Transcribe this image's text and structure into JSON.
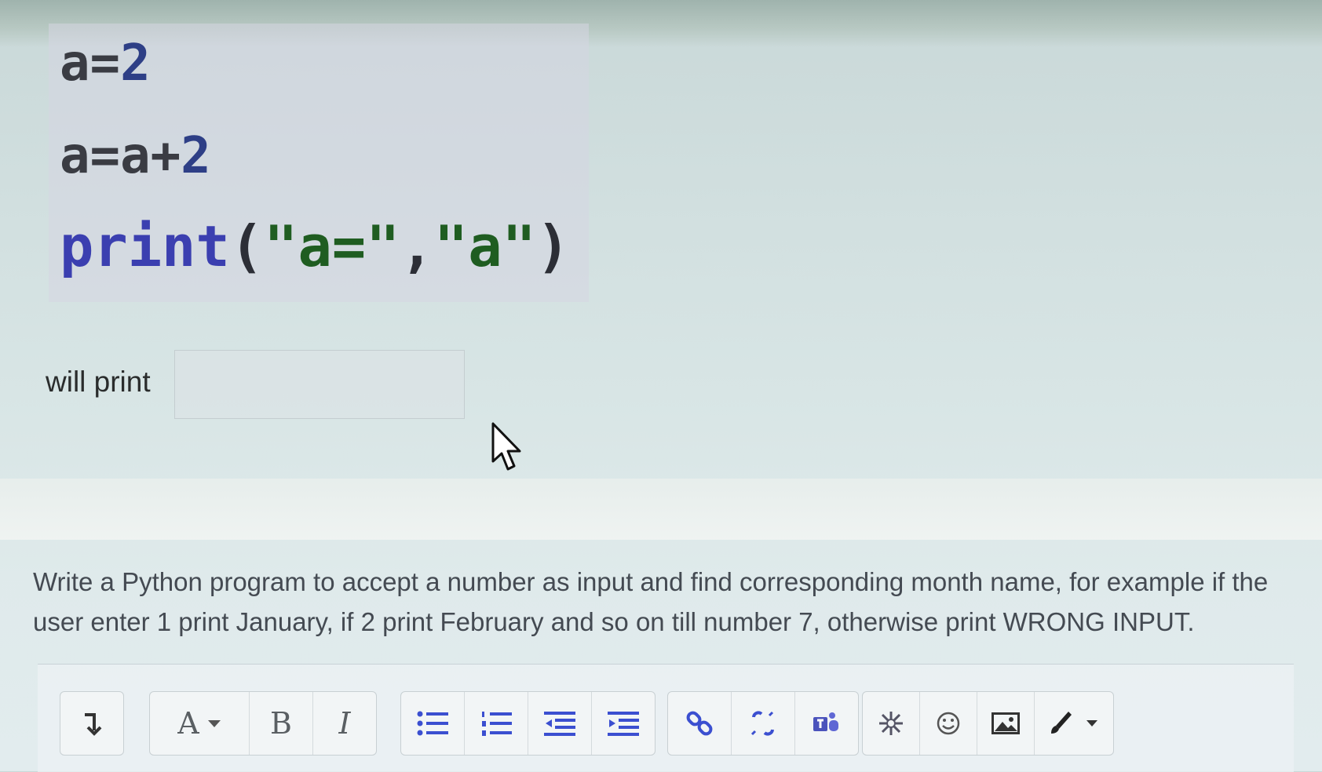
{
  "code": {
    "line1": {
      "var": "a=",
      "num": "2"
    },
    "line2": {
      "var": "a=a+",
      "num": "2"
    },
    "line3": {
      "kw": "print",
      "open": "(",
      "s1": "\"a=\"",
      "comma": ",",
      "s2": "\"a\"",
      "close": ")"
    }
  },
  "answer": {
    "label": "will print",
    "value": ""
  },
  "question": {
    "text": "Write a Python program to accept a number as input and find corresponding month name, for example if the user enter 1 print January, if 2 print February and so on till number 7, otherwise print WRONG INPUT."
  },
  "toolbar": {
    "font_label": "A",
    "bold_label": "B",
    "italic_label": "I",
    "icons": [
      "collapse-icon",
      "font-color-icon",
      "bold-icon",
      "italic-icon",
      "unordered-list-icon",
      "ordered-list-icon",
      "outdent-icon",
      "indent-icon",
      "link-icon",
      "unlink-icon",
      "teams-icon",
      "special-character-icon",
      "emoji-icon",
      "image-icon",
      "brush-icon"
    ]
  },
  "colors": {
    "keyword": "#3b3fb0",
    "number": "#2e3f86",
    "string": "#1f5d21"
  }
}
